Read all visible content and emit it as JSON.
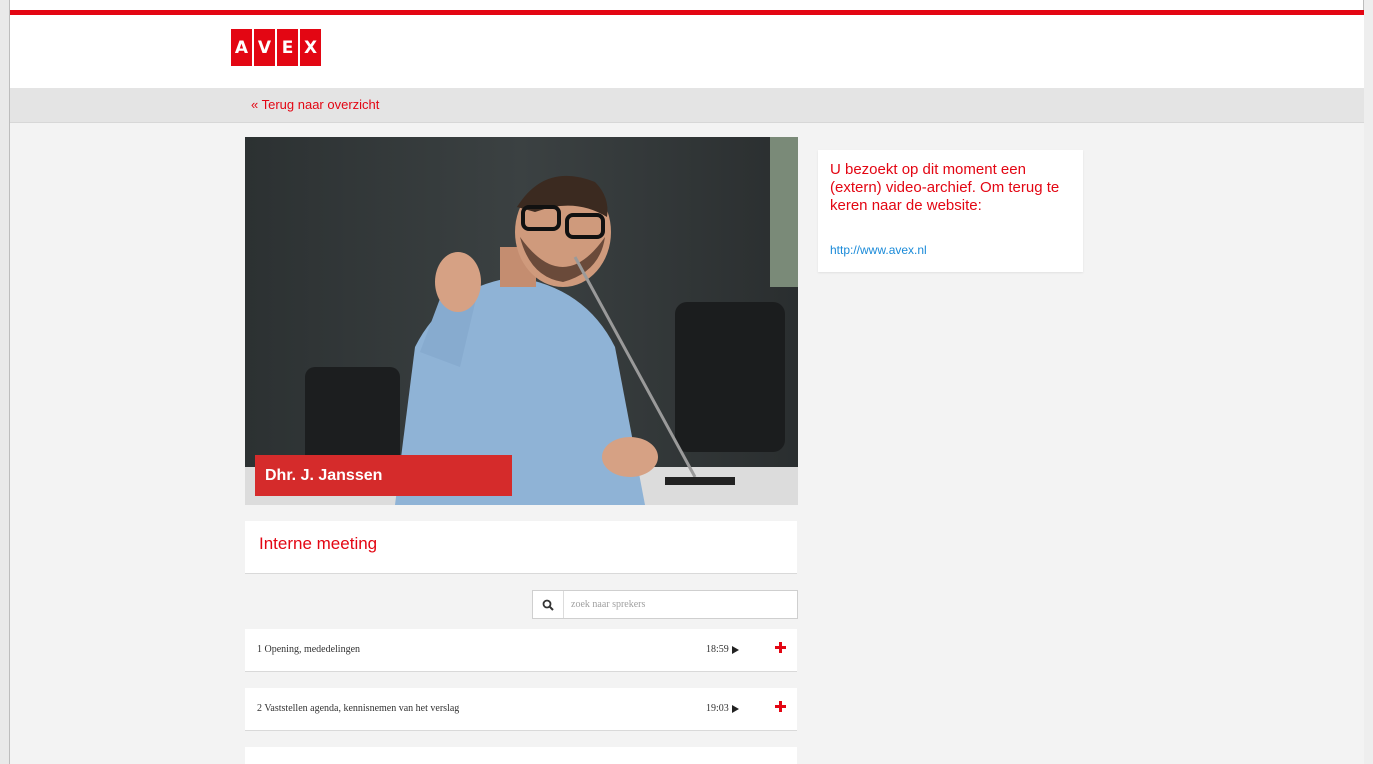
{
  "colors": {
    "brand_red": "#e30613",
    "banner_red": "#d52b2b",
    "link_blue": "#1a8ad8",
    "text_dark": "#333333"
  },
  "header": {
    "logo_letters": [
      "A",
      "V",
      "E",
      "X"
    ]
  },
  "nav": {
    "back_label": "« Terug naar overzicht"
  },
  "video": {
    "speaker_name": "Dhr. J. Janssen"
  },
  "info_box": {
    "text": "U bezoekt op dit moment een (extern) video-archief. Om terug te keren naar de website:",
    "link": "http://www.avex.nl"
  },
  "meeting": {
    "title": "Interne meeting"
  },
  "search": {
    "icon": "search-icon",
    "placeholder": "zoek naar sprekers"
  },
  "agenda": {
    "items": [
      {
        "label": "1 Opening, mededelingen",
        "time": "18:59"
      },
      {
        "label": "2 Vaststellen agenda, kennisnemen van het verslag",
        "time": "19:03"
      },
      {
        "label": "",
        "time": ""
      }
    ]
  }
}
